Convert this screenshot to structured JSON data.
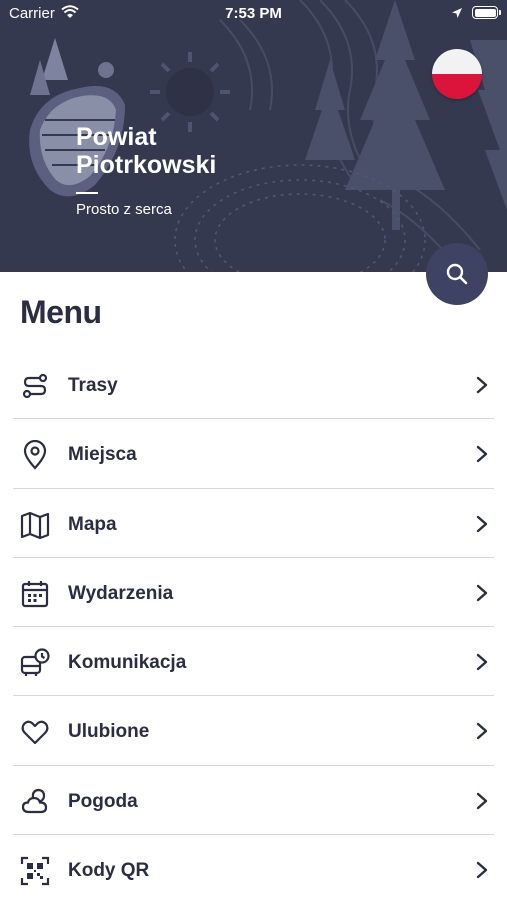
{
  "status_bar": {
    "carrier": "Carrier",
    "time": "7:53 PM"
  },
  "header": {
    "title": "Powiat Piotrkowski",
    "tagline": "Prosto z serca",
    "language_flag": "poland-flag",
    "colors": {
      "background": "#353950",
      "flag_white": "#f2f2f2",
      "flag_red": "#dc143c"
    }
  },
  "search": {
    "icon": "search-icon"
  },
  "menu": {
    "heading": "Menu",
    "items": [
      {
        "label": "Trasy",
        "icon": "route-icon"
      },
      {
        "label": "Miejsca",
        "icon": "location-pin-icon"
      },
      {
        "label": "Mapa",
        "icon": "map-icon"
      },
      {
        "label": "Wydarzenia",
        "icon": "calendar-icon"
      },
      {
        "label": "Komunikacja",
        "icon": "bus-clock-icon"
      },
      {
        "label": "Ulubione",
        "icon": "heart-icon"
      },
      {
        "label": "Pogoda",
        "icon": "weather-icon"
      },
      {
        "label": "Kody QR",
        "icon": "qr-code-icon"
      }
    ]
  },
  "colors": {
    "accent": "#3f4363",
    "text": "#2b2d42",
    "divider": "#d8d8d8"
  }
}
